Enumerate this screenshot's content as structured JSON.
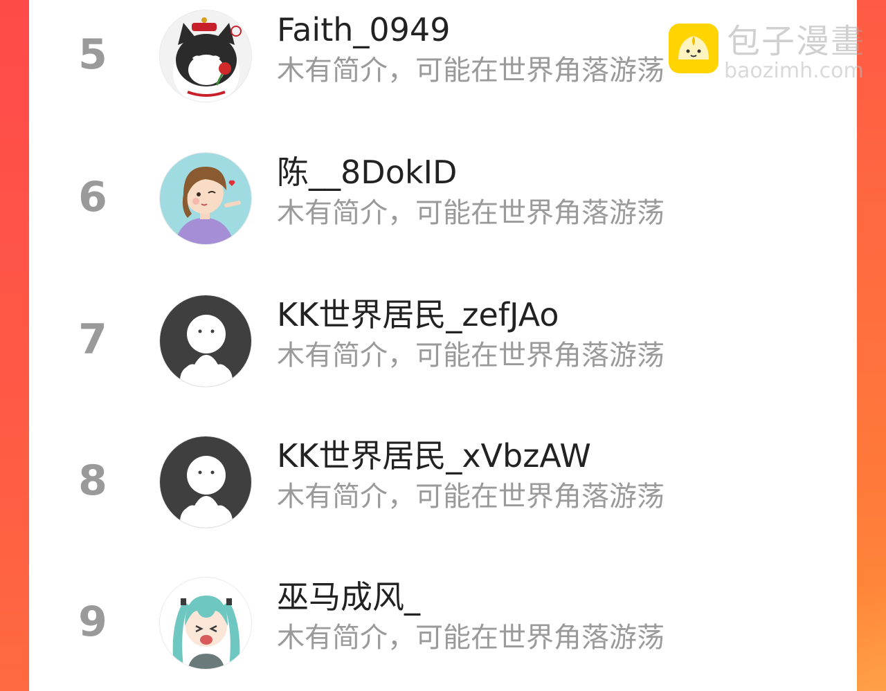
{
  "watermark": {
    "title": "包子漫畫",
    "url": "baozimh.com",
    "logo_icon": "bun-mascot-icon",
    "logo_color": "#ffd400"
  },
  "colors": {
    "accent_left": "#ff4a4a",
    "accent_right": "#ff7a3a",
    "rank_color": "#9a9a9a",
    "name_color": "#222222",
    "bio_color": "#9a9a9a"
  },
  "list": {
    "items": [
      {
        "rank": "5",
        "name": "Faith_0949",
        "bio": "木有简介，可能在世界角落游荡",
        "avatar": "cat-avatar-icon"
      },
      {
        "rank": "6",
        "name": "陈__8DokID",
        "bio": "木有简介，可能在世界角落游荡",
        "avatar": "girl-avatar-icon"
      },
      {
        "rank": "7",
        "name": "KK世界居民_zefJAo",
        "bio": "木有简介，可能在世界角落游荡",
        "avatar": "default-user-avatar-icon"
      },
      {
        "rank": "8",
        "name": "KK世界居民_xVbzAW",
        "bio": "木有简介，可能在世界角落游荡",
        "avatar": "default-user-avatar-icon"
      },
      {
        "rank": "9",
        "name": "巫马成风_",
        "bio": "木有简介，可能在世界角落游荡",
        "avatar": "anime-girl-avatar-icon"
      }
    ]
  }
}
